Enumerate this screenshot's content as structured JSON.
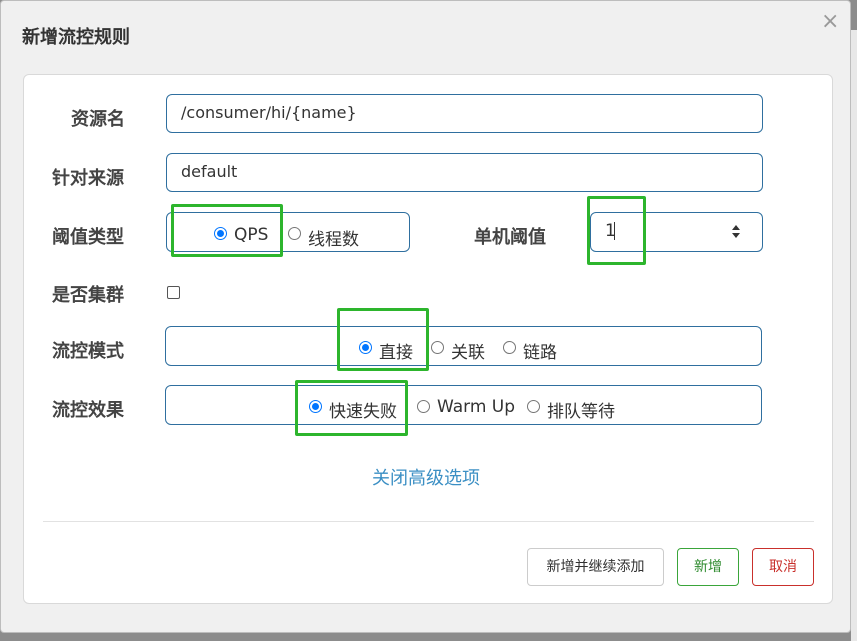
{
  "dialog": {
    "title": "新增流控规则",
    "close_glyph": "×"
  },
  "form": {
    "resource_label": "资源名",
    "resource_value": "/consumer/hi/{name}",
    "origin_label": "针对来源",
    "origin_value": "default",
    "threshold_type_label": "阈值类型",
    "threshold_type_options": [
      "QPS",
      "线程数"
    ],
    "threshold_type_selected": "QPS",
    "single_threshold_label": "单机阈值",
    "single_threshold_value": "1",
    "cluster_label": "是否集群",
    "cluster_checked": false,
    "control_mode_label": "流控模式",
    "control_mode_options": [
      "直接",
      "关联",
      "链路"
    ],
    "control_mode_selected": "直接",
    "control_effect_label": "流控效果",
    "control_effect_options": [
      "快速失败",
      "Warm Up",
      "排队等待"
    ],
    "control_effect_selected": "快速失败",
    "advanced_toggle": "关闭高级选项"
  },
  "footer": {
    "add_continue_label": "新增并继续添加",
    "add_label": "新增",
    "cancel_label": "取消"
  },
  "colors": {
    "highlight": "#2db52d",
    "radio_checked": "#0075ff",
    "link": "#3b8fc4",
    "input_border": "#2f6f9f"
  }
}
